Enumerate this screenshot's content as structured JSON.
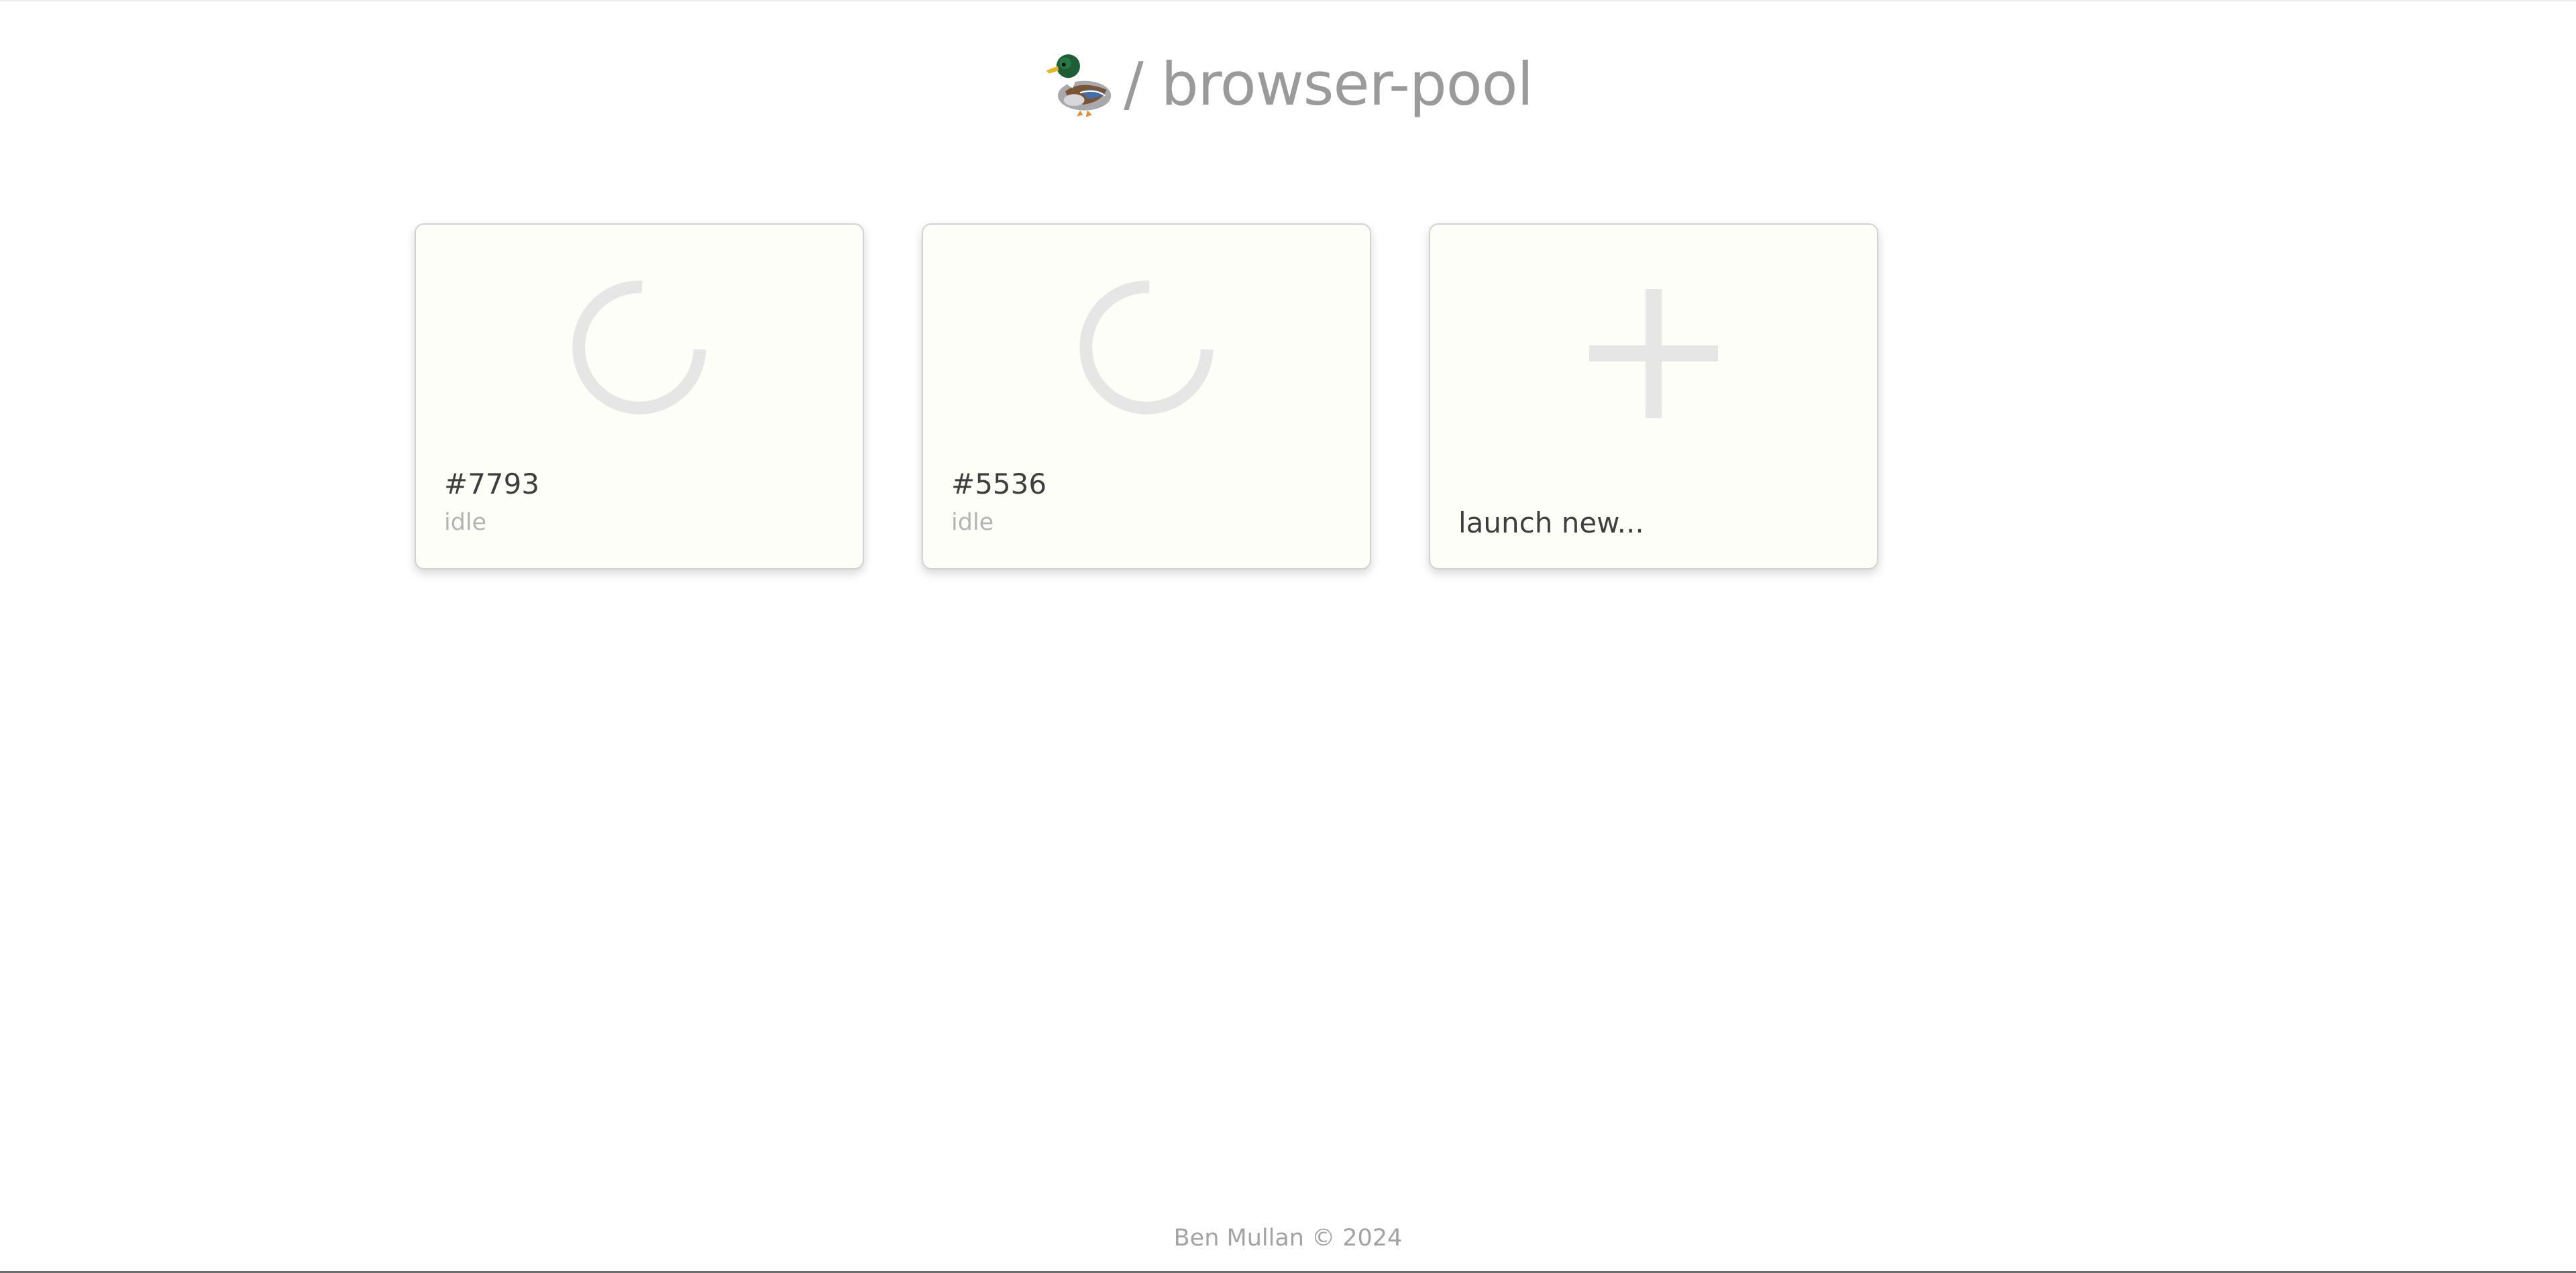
{
  "header": {
    "logo_icon": "duck-icon",
    "title": "/ browser-pool"
  },
  "browsers": [
    {
      "id": "#7793",
      "status": "idle",
      "icon": "loading-spinner-icon"
    },
    {
      "id": "#5536",
      "status": "idle",
      "icon": "loading-spinner-icon"
    }
  ],
  "launch_card": {
    "label": "launch new...",
    "icon": "plus-icon"
  },
  "footer": {
    "text": "Ben Mullan © 2024"
  },
  "colors": {
    "card_background": "#fefef9",
    "title_gray": "#9a9a9a",
    "spinner_gray": "#e6e6e6",
    "text_dark": "#3e3e3e",
    "text_muted": "#b4b4b4"
  }
}
